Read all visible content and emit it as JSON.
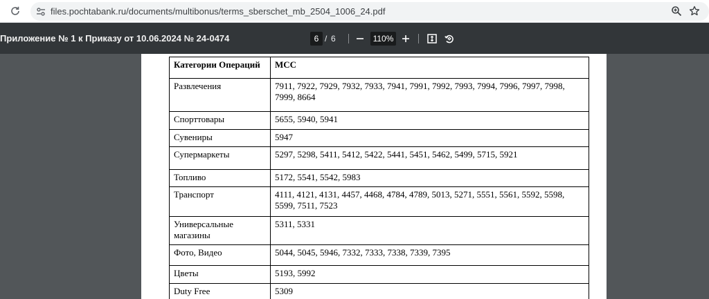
{
  "browser": {
    "url": "files.pochtabank.ru/documents/multibonus/terms_sberschet_mb_2504_1006_24.pdf"
  },
  "toolbar": {
    "title": "Приложение № 1 к Приказу от 10.06.2024 № 24-0474",
    "page_current": "6",
    "page_separator": "/",
    "page_total": "6",
    "zoom": "110%"
  },
  "table": {
    "headers": [
      "Категории Операций",
      "MCC"
    ],
    "rows": [
      {
        "category": "Развлечения",
        "mcc": "7911, 7922, 7929, 7932, 7933, 7941, 7991, 7992, 7993, 7994, 7996, 7997, 7998, 7999, 8664"
      },
      {
        "category": "Спорттовары",
        "mcc": "5655, 5940, 5941"
      },
      {
        "category": "Сувениры",
        "mcc": "5947"
      },
      {
        "category": "Супермаркеты",
        "mcc": "5297, 5298, 5411, 5412, 5422, 5441, 5451, 5462, 5499, 5715, 5921"
      },
      {
        "category": "Топливо",
        "mcc": "5172, 5541, 5542, 5983"
      },
      {
        "category": "Транспорт",
        "mcc": "4111, 4121, 4131, 4457, 4468, 4784, 4789, 5013, 5271, 5551, 5561, 5592, 5598, 5599, 7511, 7523"
      },
      {
        "category": "Универсальные магазины",
        "mcc": "5311, 5331"
      },
      {
        "category": "Фото, Видео",
        "mcc": "5044, 5045, 5946, 7332, 7333, 7338, 7339, 7395"
      },
      {
        "category": "Цветы",
        "mcc": "5193, 5992"
      },
      {
        "category": "Duty Free",
        "mcc": "5309"
      }
    ]
  },
  "icons": {
    "reload": "reload-icon",
    "site_info": "site-info-icon",
    "zoom": "zoom-icon",
    "bookmark": "star-icon",
    "zoom_out": "minus-icon",
    "zoom_in": "plus-icon",
    "fit": "fit-page-icon",
    "rotate": "rotate-icon"
  }
}
